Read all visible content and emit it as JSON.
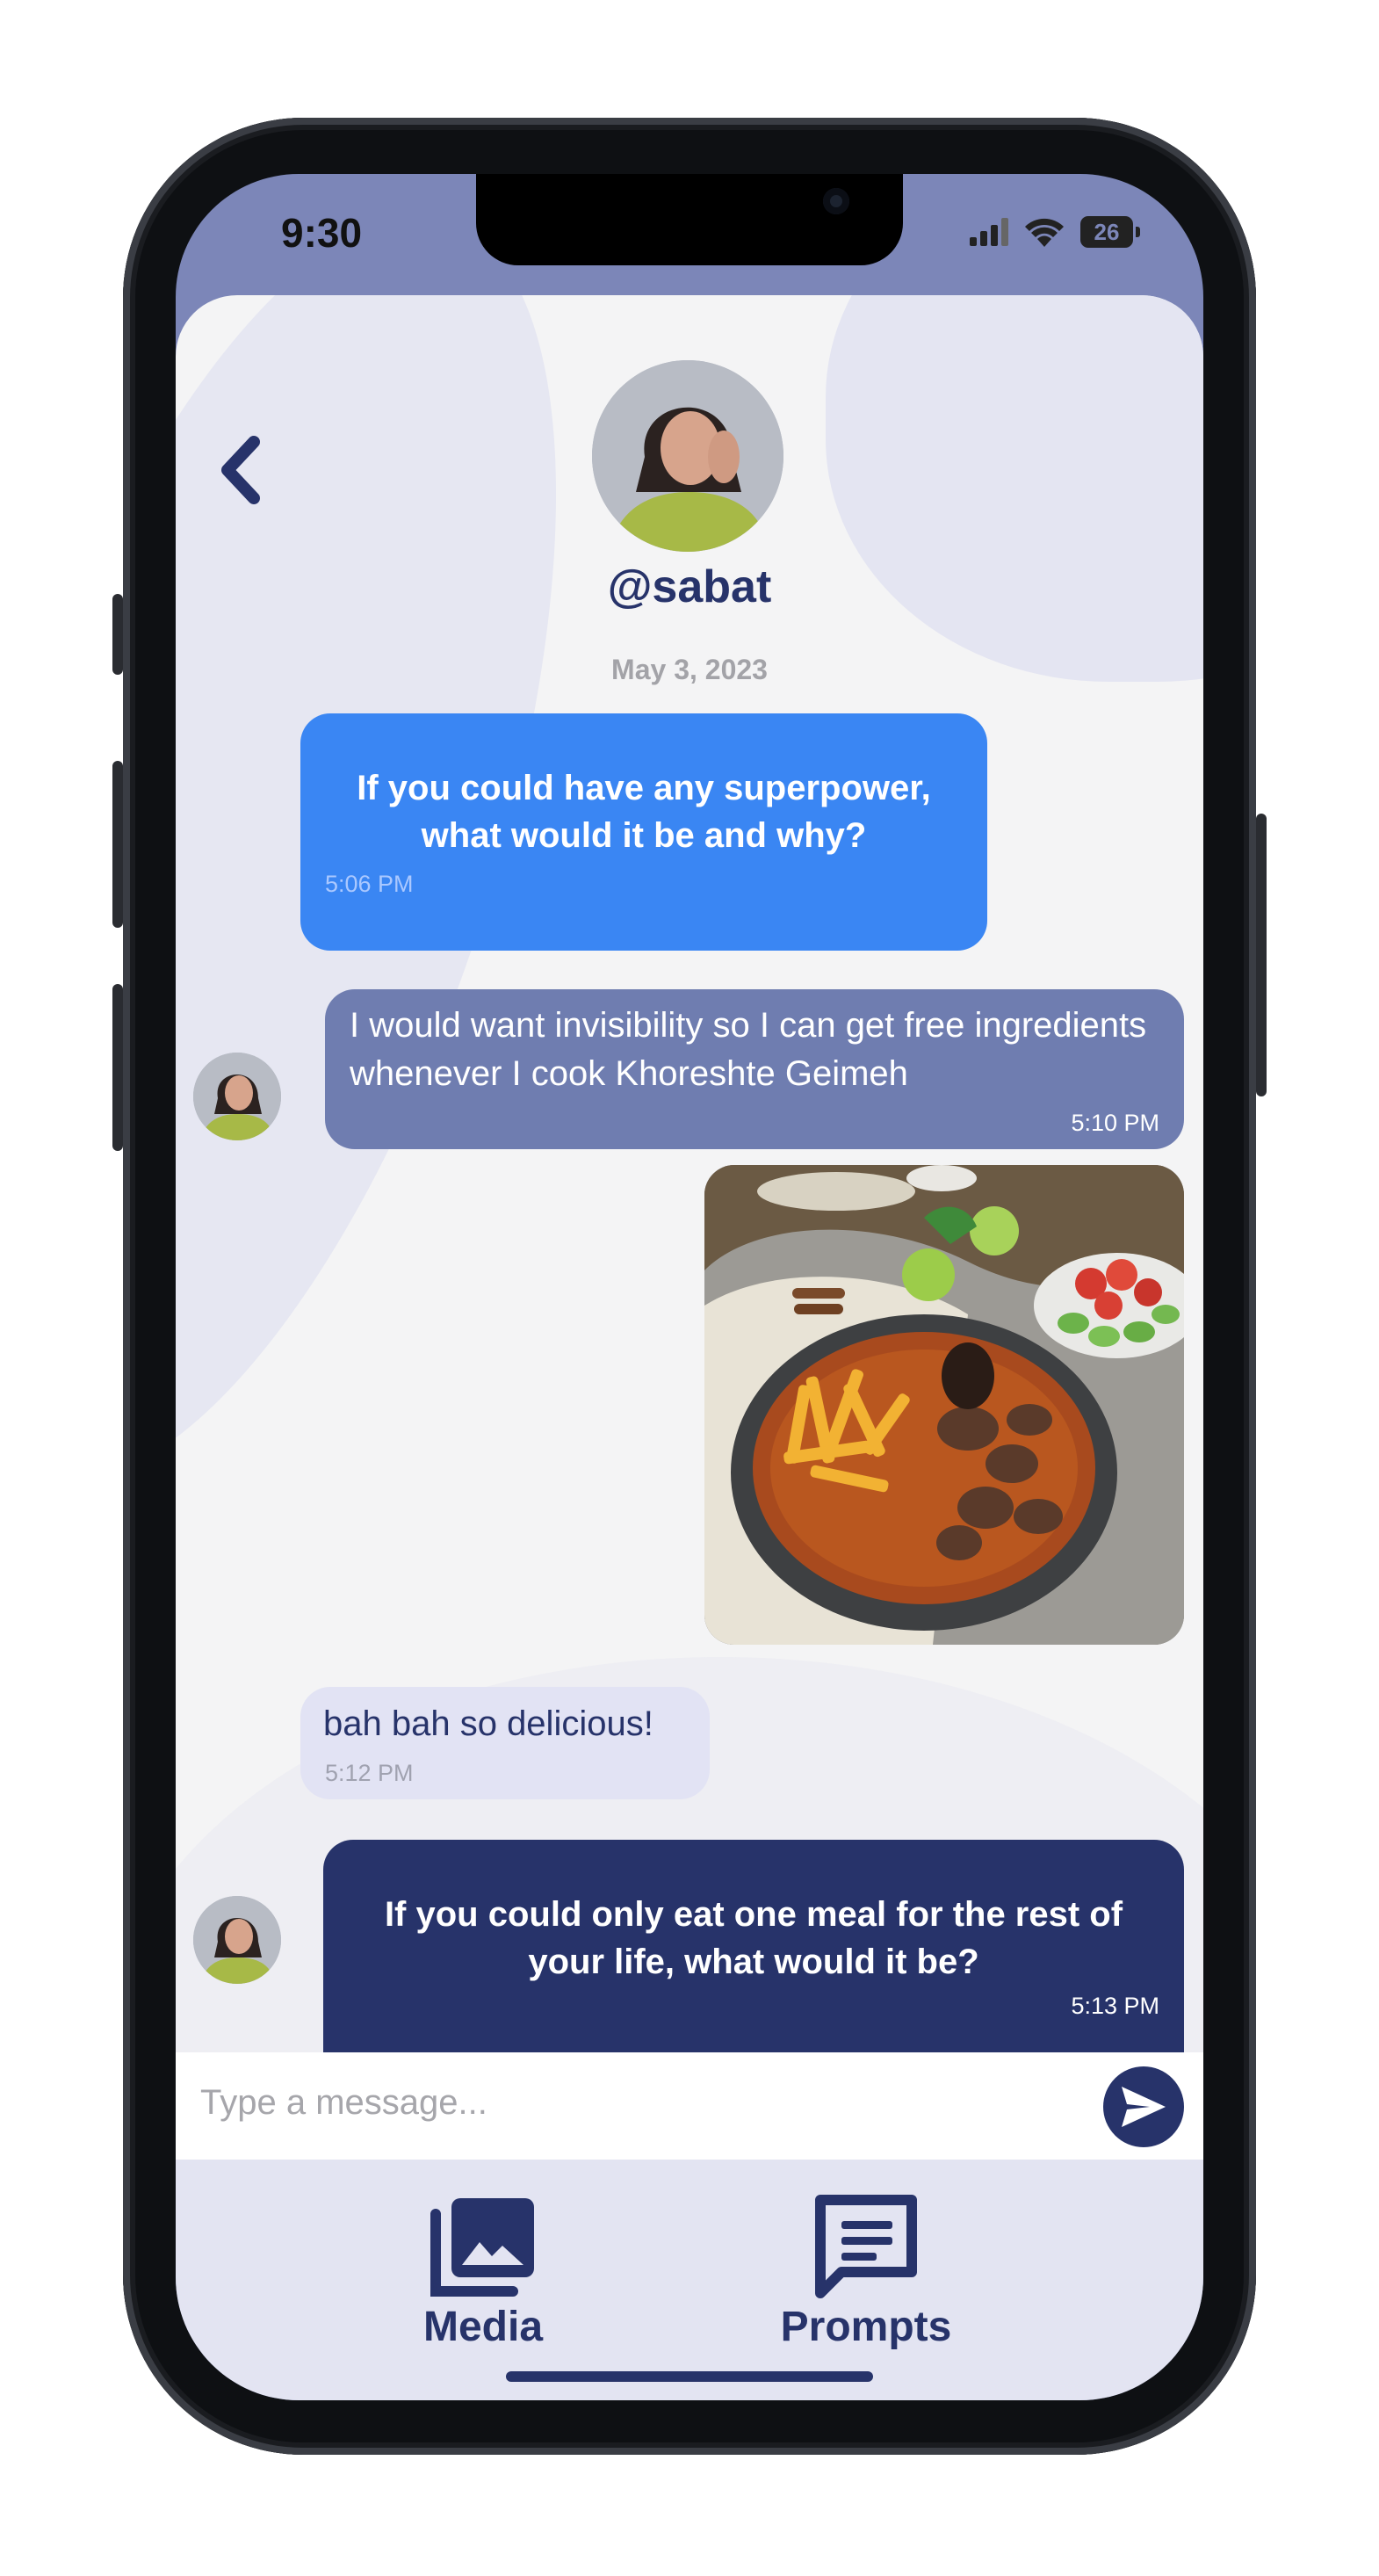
{
  "status_bar": {
    "time": "9:30",
    "battery": "26"
  },
  "header": {
    "handle": "@sabat",
    "date": "May 3, 2023"
  },
  "messages": [
    {
      "sender": "other",
      "type": "prompt",
      "text": "If you could have any superpower, what would it be and why?",
      "time": "5:06 PM"
    },
    {
      "sender": "me",
      "type": "text",
      "text": "I would want invisibility so I can get free ingredients whenever I cook Khoreshte Geimeh",
      "time": "5:10 PM"
    },
    {
      "sender": "me",
      "type": "image"
    },
    {
      "sender": "other",
      "type": "text",
      "text": "bah bah so delicious!",
      "time": "5:12 PM"
    },
    {
      "sender": "me",
      "type": "prompt",
      "text": "If you could only eat one meal for the rest of your life, what would it be?",
      "time": "5:13 PM"
    }
  ],
  "composer": {
    "placeholder": "Type a message..."
  },
  "nav": {
    "media_label": "Media",
    "prompts_label": "Prompts"
  },
  "colors": {
    "accent_dark": "#27336a",
    "bubble_blue": "#3a86f3",
    "bubble_slate": "#6f7db0",
    "bubble_light": "#e2e3f4",
    "status_bar_bg": "#7c86b8"
  },
  "icons": [
    "back-chevron-icon",
    "signal-icon",
    "wifi-icon",
    "battery-icon",
    "send-icon",
    "media-gallery-icon",
    "prompts-chat-icon"
  ]
}
